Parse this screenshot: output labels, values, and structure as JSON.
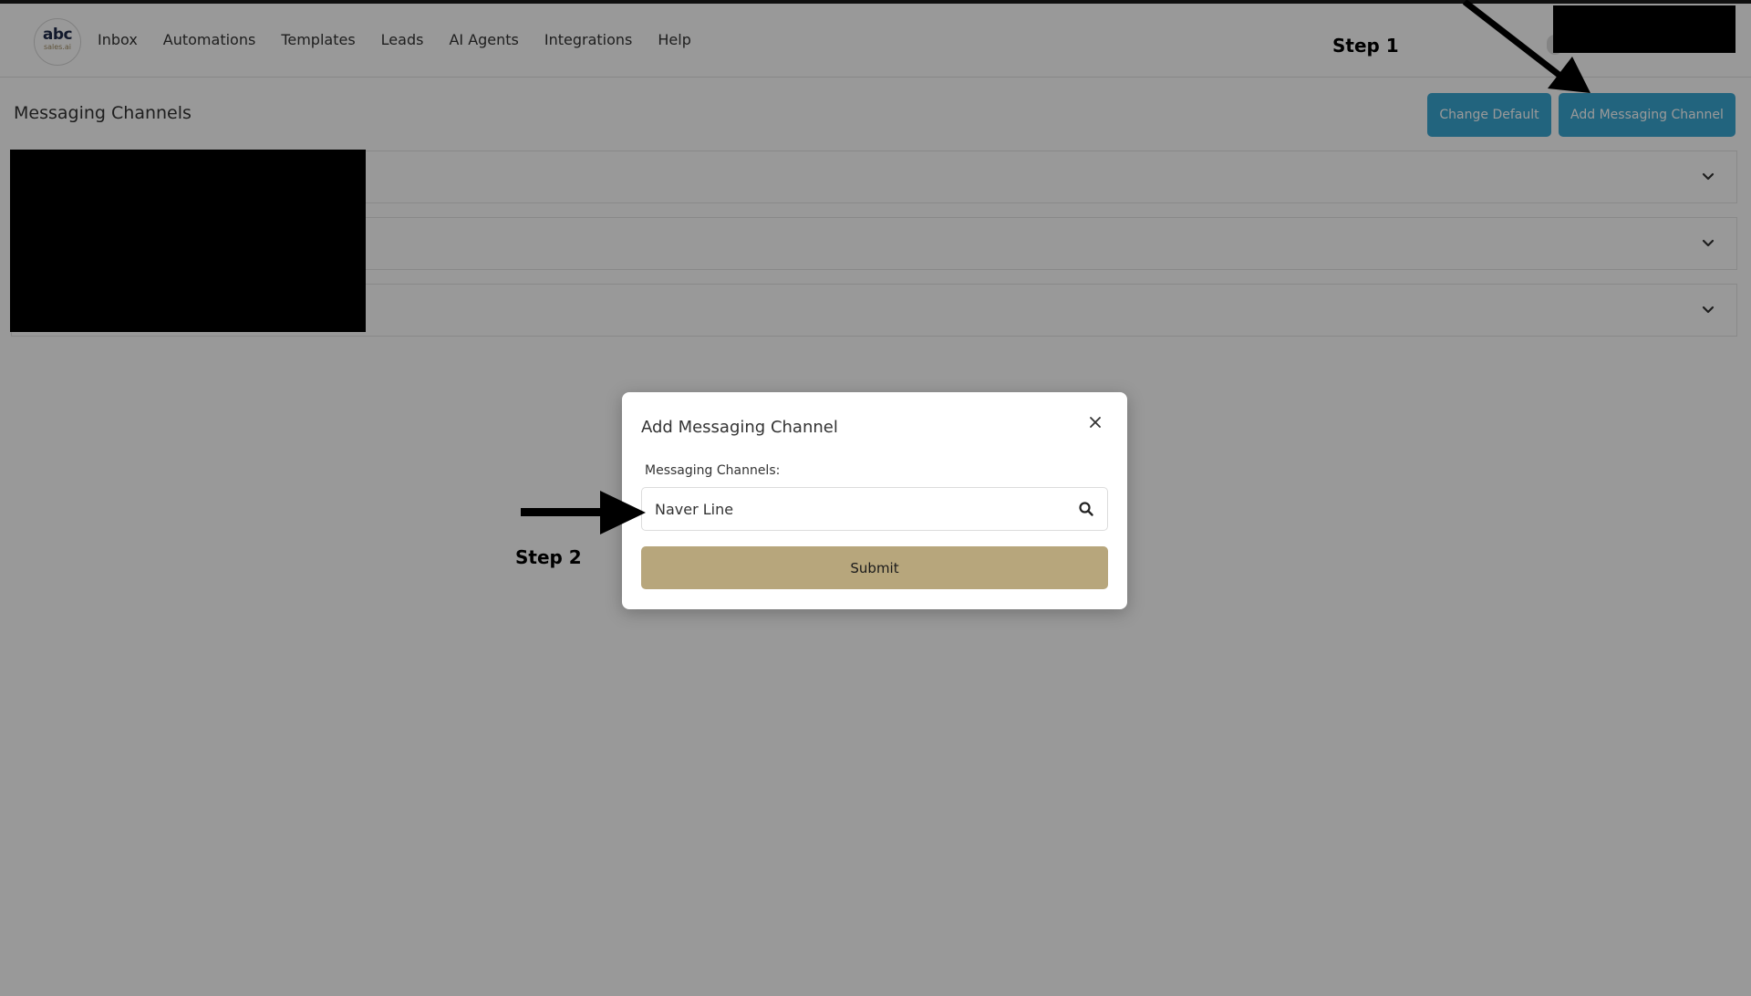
{
  "header": {
    "logo_main": "abc",
    "logo_sub": "sales.ai",
    "nav": [
      "Inbox",
      "Automations",
      "Templates",
      "Leads",
      "AI Agents",
      "Integrations",
      "Help"
    ]
  },
  "page": {
    "title": "Messaging Channels",
    "change_default_label": "Change Default",
    "add_channel_label": "Add Messaging Channel"
  },
  "modal": {
    "title": "Add Messaging Channel",
    "field_label": "Messaging Channels:",
    "field_value": "Naver Line",
    "submit_label": "Submit"
  },
  "annotations": {
    "step1": "Step 1",
    "step2": "Step 2"
  },
  "colors": {
    "primary_button": "#3aa7d3",
    "submit_button": "#b7a67c",
    "overlay": "rgba(0,0,0,0.4)"
  }
}
